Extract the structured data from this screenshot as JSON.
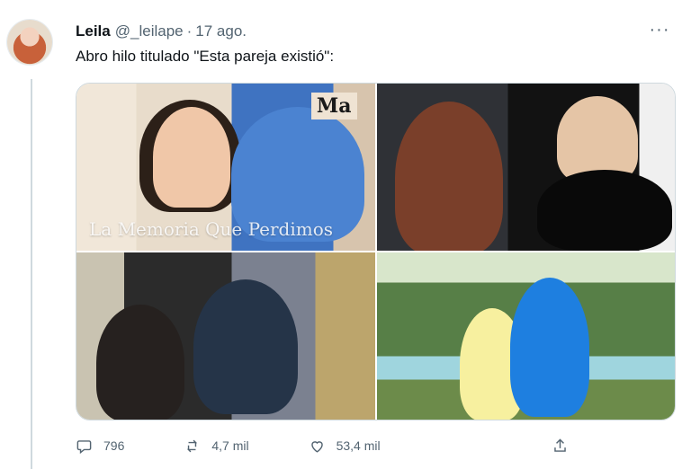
{
  "tweet": {
    "name": "Leila",
    "handle": "@_leilape",
    "separator": "·",
    "date": "17 ago.",
    "more": "···",
    "text": "Abro hilo titulado \"Esta pareja existió\":"
  },
  "media": {
    "photo1_badge": "Ma",
    "photo1_caption": "La Memoria Que Perdimos"
  },
  "actions": {
    "reply_count": "796",
    "retweet_count": "4,7 mil",
    "like_count": "53,4 mil"
  },
  "icons": [
    "reply-icon",
    "retweet-icon",
    "like-icon",
    "share-icon"
  ]
}
